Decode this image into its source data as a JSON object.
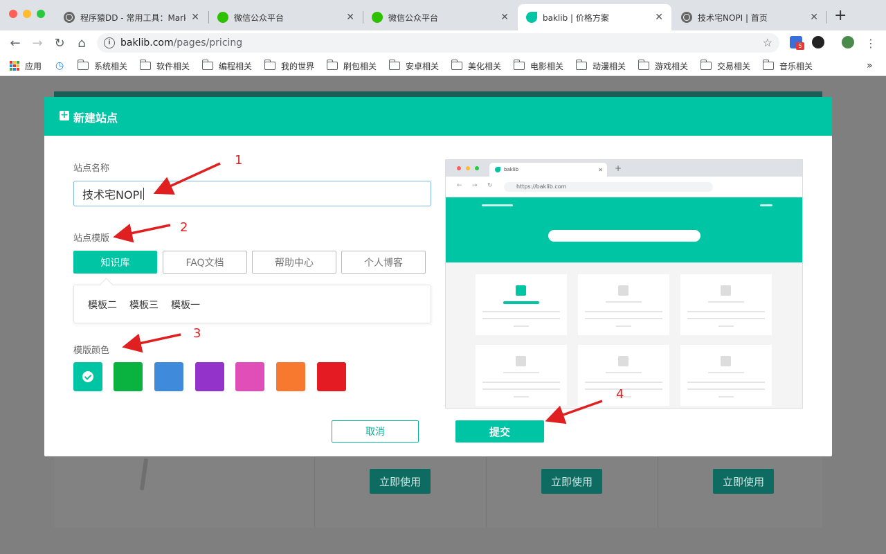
{
  "browser": {
    "tabs": [
      {
        "title": "程序猿DD - 常用工具：Markd",
        "icon": "globe-icon",
        "active": false
      },
      {
        "title": "微信公众平台",
        "icon": "wechat-icon",
        "active": false
      },
      {
        "title": "微信公众平台",
        "icon": "wechat-icon",
        "active": false
      },
      {
        "title": "baklib | 价格方案",
        "icon": "baklib-icon",
        "active": true
      },
      {
        "title": "技术宅NOPI | 首页",
        "icon": "globe-icon",
        "active": false
      }
    ],
    "url_host": "baklib.com",
    "url_path": "/pages/pricing",
    "extension_badge": "5",
    "bookmarks": [
      "应用",
      "系统相关",
      "软件相关",
      "编程相关",
      "我的世界",
      "刷包相关",
      "安卓相关",
      "美化相关",
      "电影相关",
      "动漫相关",
      "游戏相关",
      "交易相关",
      "音乐相关"
    ],
    "bookmarks_overflow": "»"
  },
  "background_page": {
    "use_buttons": [
      "立即使用",
      "立即使用",
      "立即使用"
    ]
  },
  "modal": {
    "title": "新建站点",
    "site_name_label": "站点名称",
    "site_name_value": "技术宅NOPI",
    "template_label": "站点模版",
    "template_tabs": [
      "知识库",
      "FAQ文档",
      "帮助中心",
      "个人博客"
    ],
    "active_template_tab": "知识库",
    "template_options": [
      "模板二",
      "模板三",
      "模板一"
    ],
    "color_label": "模版颜色",
    "colors": [
      "#00c5a5",
      "#0ab23f",
      "#3f8adb",
      "#9333c9",
      "#e04fb8",
      "#f7792f",
      "#e41b23"
    ],
    "selected_color": "#00c5a5",
    "cancel_label": "取消",
    "submit_label": "提交",
    "preview": {
      "tab_title": "baklib",
      "url": "https://baklib.com"
    }
  },
  "annotations": [
    "1",
    "2",
    "3",
    "4"
  ]
}
